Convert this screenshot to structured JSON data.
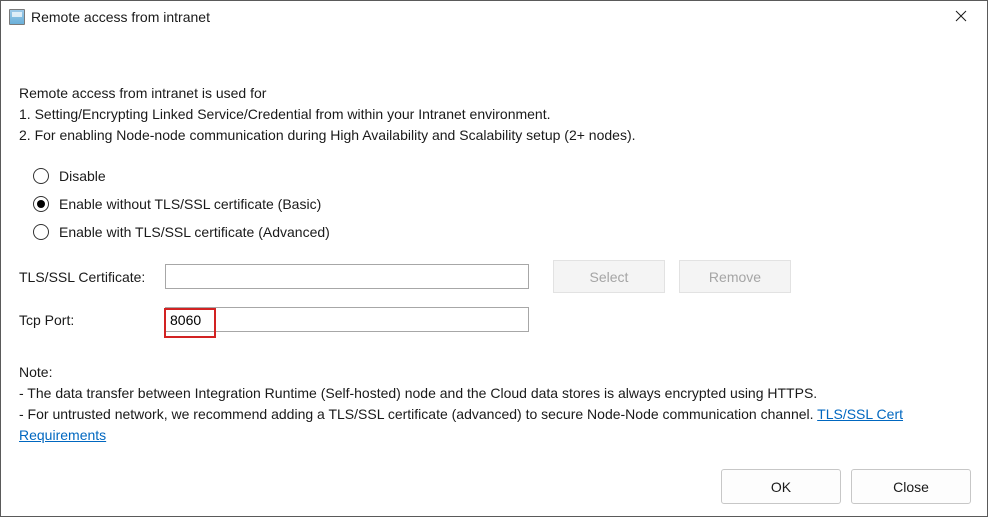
{
  "title": "Remote access from intranet",
  "intro": {
    "heading": "Remote access from intranet is used for",
    "line1": "1. Setting/Encrypting Linked Service/Credential from within your Intranet environment.",
    "line2": "2. For enabling Node-node communication during High Availability and Scalability setup (2+ nodes)."
  },
  "radios": {
    "disable": "Disable",
    "basic": "Enable without TLS/SSL certificate (Basic)",
    "advanced": "Enable with TLS/SSL certificate (Advanced)"
  },
  "form": {
    "cert_label": "TLS/SSL Certificate:",
    "cert_value": "",
    "select_label": "Select",
    "remove_label": "Remove",
    "port_label": "Tcp Port:",
    "port_value": "8060"
  },
  "note": {
    "header": "Note:",
    "line1": " - The data transfer between Integration Runtime (Self-hosted) node and the Cloud data stores is always encrypted using HTTPS.",
    "line2_prefix": " - For untrusted network, we recommend adding a TLS/SSL certificate (advanced) to secure Node-Node communication channel. ",
    "link": "TLS/SSL Cert Requirements"
  },
  "footer": {
    "ok": "OK",
    "close": "Close"
  }
}
